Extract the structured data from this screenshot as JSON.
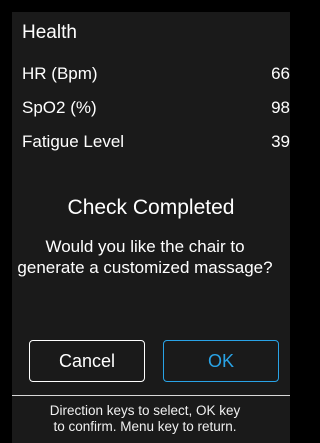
{
  "health": {
    "title": "Health",
    "metrics": [
      {
        "label": "HR (Bpm)",
        "value": "66"
      },
      {
        "label": "SpO2 (%)",
        "value": "98"
      },
      {
        "label": "Fatigue Level",
        "value": "39"
      }
    ]
  },
  "dialog": {
    "title": "Check Completed",
    "question_line1": "Would you like the chair to",
    "question_line2": "generate a customized massage?",
    "cancel_label": "Cancel",
    "ok_label": "OK"
  },
  "hint": {
    "line1": "Direction keys to select, OK key",
    "line2": "to confirm. Menu key to return."
  },
  "colors": {
    "background": "#1a1a1a",
    "accent": "#29a3e6",
    "text": "#ffffff"
  }
}
